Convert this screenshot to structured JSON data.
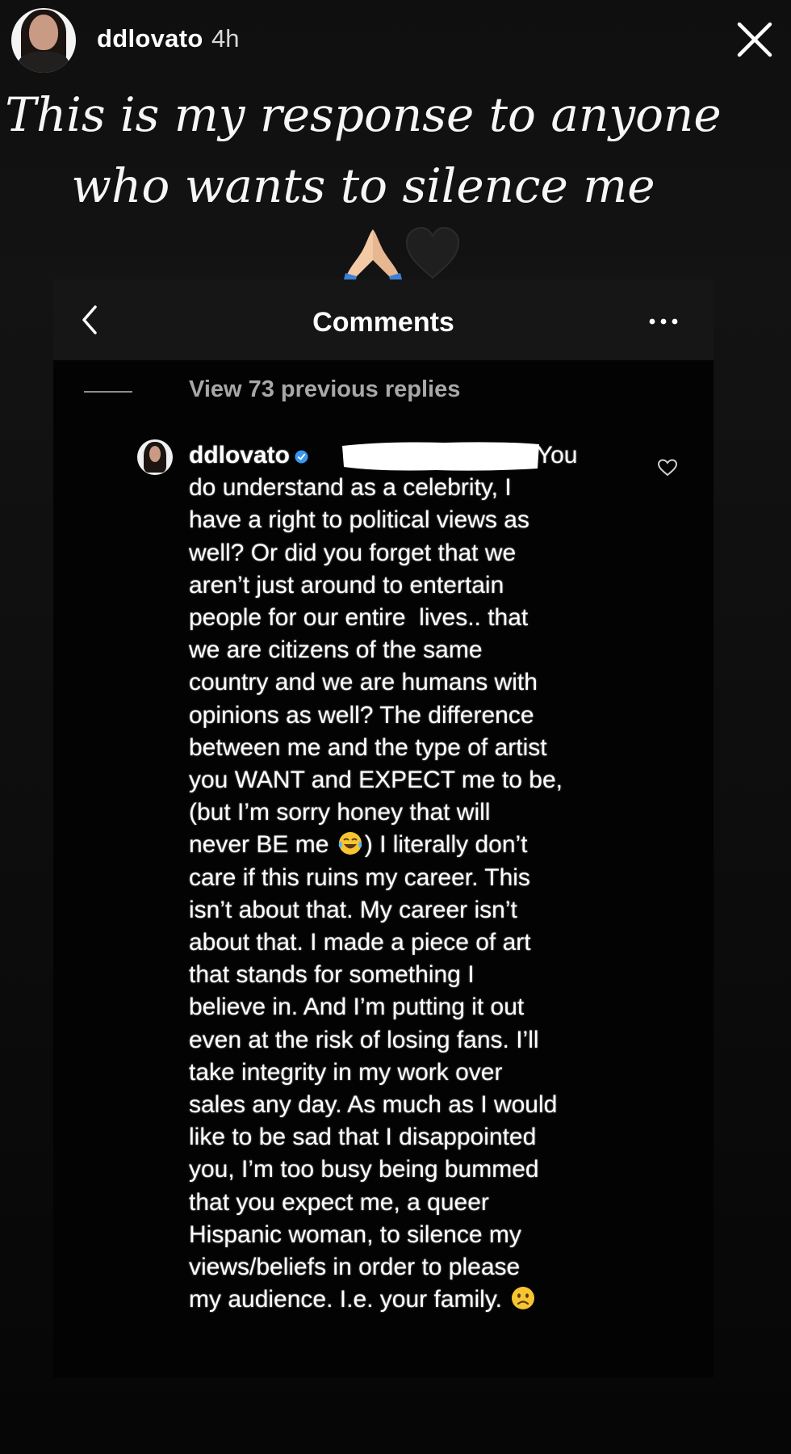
{
  "story": {
    "username": "ddlovato",
    "time": "4h",
    "caption": "This is my response to anyone who wants to silence me",
    "caption_emojis": [
      "folded-hands-icon",
      "black-heart-icon"
    ]
  },
  "comments_screen": {
    "title": "Comments",
    "view_previous": "View 73 previous replies",
    "comment": {
      "username": "ddlovato",
      "verified": true,
      "lines": [
        "You",
        "do understand as a celebrity, I",
        "have a right to political views as",
        "well? Or did you forget that we",
        "aren’t just around to entertain",
        "people for our entire  lives.. that",
        "we are citizens of the same",
        "country and we are humans with",
        "opinions as well? The difference",
        "between me and the type of artist",
        "you WANT and EXPECT me to be,",
        "(but I’m sorry honey that will",
        "never BE me",
        ") I literally don’t",
        "care if this ruins my career. This",
        "isn’t about that. My career isn’t",
        "about that. I made a piece of art",
        "that stands for something I",
        "believe in. And I’m putting it out",
        "even at the risk of losing fans. I’ll",
        "take integrity in my work over",
        "sales any day. As much as I would",
        "like to be sad that I disappointed",
        "you, I’m too busy being bummed",
        "that you expect me, a queer",
        "Hispanic woman, to silence my",
        "views/beliefs in order to please",
        "my audience. I.e. your family."
      ],
      "inline_emojis": [
        "laughing-tears-icon",
        "slightly-frowning-icon"
      ]
    }
  },
  "colors": {
    "background": "#000000",
    "panel_header": "#161616",
    "secondary_text": "#a8a8a8",
    "verified_blue": "#3897f0"
  }
}
